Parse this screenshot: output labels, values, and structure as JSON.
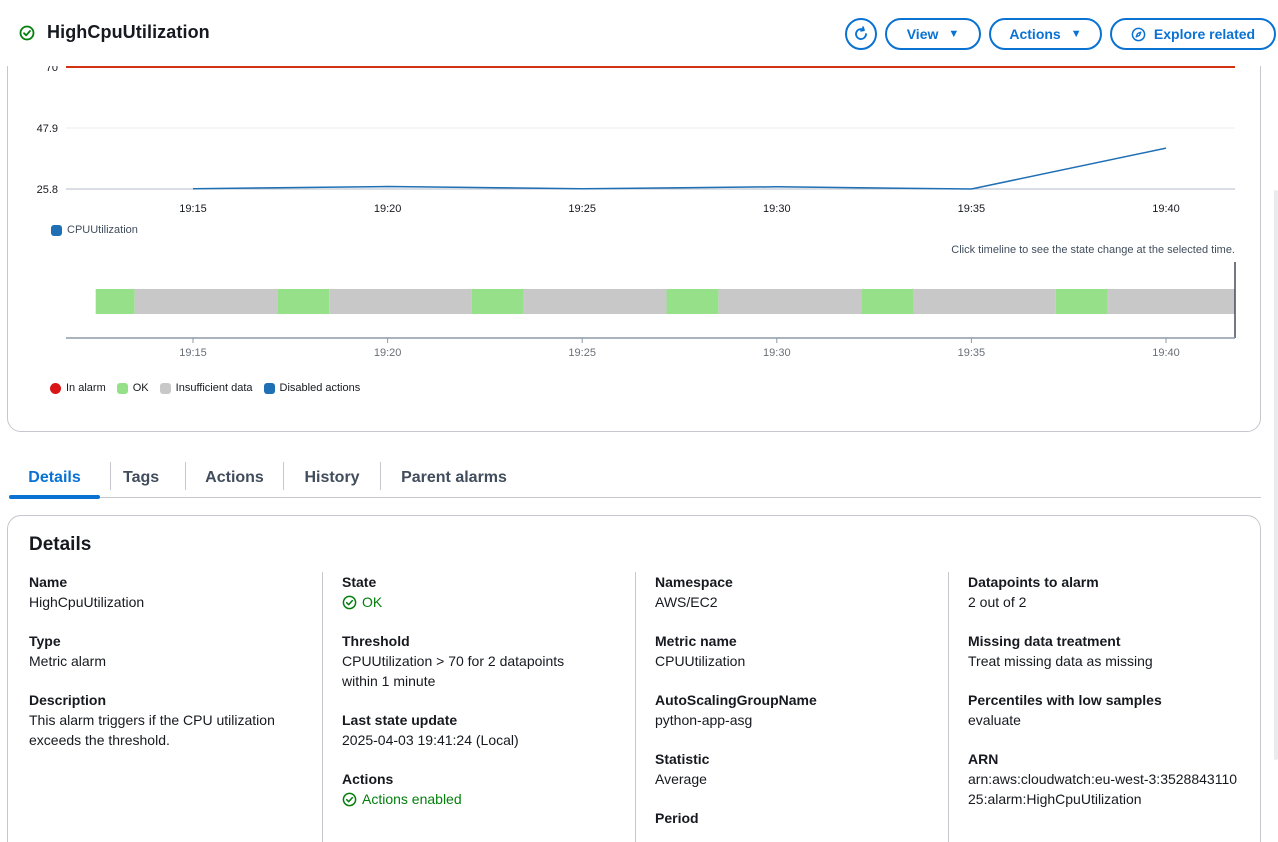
{
  "header": {
    "title": "HighCpuUtilization",
    "view_label": "View",
    "actions_label": "Actions",
    "explore_label": "Explore related"
  },
  "chart_data": {
    "type": "line",
    "y_ticks": [
      "70",
      "47.9",
      "25.8"
    ],
    "ylim": [
      25.8,
      70
    ],
    "threshold": 70,
    "x_ticks": [
      "19:15",
      "19:20",
      "19:25",
      "19:30",
      "19:35",
      "19:40"
    ],
    "series": [
      {
        "name": "CPUUtilization",
        "x": [
          "19:15",
          "19:20",
          "19:25",
          "19:30",
          "19:35",
          "19:40"
        ],
        "values": [
          25.9,
          26.7,
          25.9,
          26.6,
          25.8,
          40.6
        ]
      }
    ],
    "colors": {
      "series": "#1f6fb5",
      "threshold": "#d13212",
      "ok": "#97e08a",
      "insufficient": "#c8c8c8",
      "in_alarm": "#d91515",
      "disabled": "#1f6fb5"
    },
    "timeline": {
      "segments": [
        {
          "state": "ok",
          "start": "19:12:30",
          "end": "19:13:30"
        },
        {
          "state": "insufficient",
          "start": "19:13:30",
          "end": "19:17:10"
        },
        {
          "state": "ok",
          "start": "19:17:10",
          "end": "19:18:30"
        },
        {
          "state": "insufficient",
          "start": "19:18:30",
          "end": "19:22:10"
        },
        {
          "state": "ok",
          "start": "19:22:10",
          "end": "19:23:30"
        },
        {
          "state": "insufficient",
          "start": "19:23:30",
          "end": "19:27:10"
        },
        {
          "state": "ok",
          "start": "19:27:10",
          "end": "19:28:30"
        },
        {
          "state": "insufficient",
          "start": "19:28:30",
          "end": "19:32:10"
        },
        {
          "state": "ok",
          "start": "19:32:10",
          "end": "19:33:30"
        },
        {
          "state": "insufficient",
          "start": "19:33:30",
          "end": "19:37:10"
        },
        {
          "state": "ok",
          "start": "19:37:10",
          "end": "19:38:30"
        },
        {
          "state": "insufficient",
          "start": "19:38:30",
          "end": "19:42:10"
        },
        {
          "state": "ok",
          "start": "19:42:10",
          "end": "19:42:30"
        }
      ]
    }
  },
  "timeline_hint": "Click timeline to see the state change at the selected time.",
  "state_legend": {
    "in_alarm": "In alarm",
    "ok": "OK",
    "insufficient": "Insufficient data",
    "disabled": "Disabled actions"
  },
  "tabs": [
    {
      "label": "Details"
    },
    {
      "label": "Tags"
    },
    {
      "label": "Actions"
    },
    {
      "label": "History"
    },
    {
      "label": "Parent alarms"
    }
  ],
  "details": {
    "title": "Details",
    "name_label": "Name",
    "name_value": "HighCpuUtilization",
    "type_label": "Type",
    "type_value": "Metric alarm",
    "description_label": "Description",
    "description_value": "This alarm triggers if the CPU utilization exceeds the threshold.",
    "state_label": "State",
    "state_value": "OK",
    "threshold_label": "Threshold",
    "threshold_value": "CPUUtilization > 70 for 2 datapoints within 1 minute",
    "last_update_label": "Last state update",
    "last_update_value": "2025-04-03 19:41:24 (Local)",
    "actions_label": "Actions",
    "actions_value": "Actions enabled",
    "namespace_label": "Namespace",
    "namespace_value": "AWS/EC2",
    "metric_label": "Metric name",
    "metric_value": "CPUUtilization",
    "asg_label": "AutoScalingGroupName",
    "asg_value": "python-app-asg",
    "statistic_label": "Statistic",
    "statistic_value": "Average",
    "period_label": "Period",
    "datapoints_label": "Datapoints to alarm",
    "datapoints_value": "2 out of 2",
    "missing_label": "Missing data treatment",
    "missing_value": "Treat missing data as missing",
    "percentiles_label": "Percentiles with low samples",
    "percentiles_value": "evaluate",
    "arn_label": "ARN",
    "arn_value": "arn:aws:cloudwatch:eu-west-3:352884311025:alarm:HighCpuUtilization"
  }
}
